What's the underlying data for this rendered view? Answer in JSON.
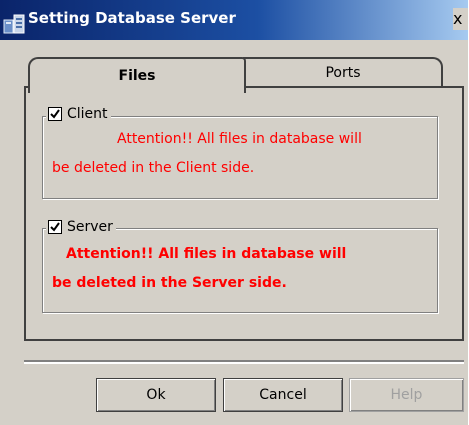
{
  "window": {
    "title": "Setting Database Server",
    "close_label": "x"
  },
  "tabs": [
    {
      "label": "Files",
      "selected": true
    },
    {
      "label": "Ports",
      "selected": false
    }
  ],
  "groups": {
    "client": {
      "label": "Client",
      "checked": true,
      "warning_line1": "Attention!! All files in database will",
      "warning_line2": "be deleted in the Client side."
    },
    "server": {
      "label": "Server",
      "checked": true,
      "warning_line1": "Attention!! All files in database will",
      "warning_line2": "be deleted in the Server side."
    }
  },
  "buttons": {
    "ok": "Ok",
    "cancel": "Cancel",
    "help": "Help"
  },
  "colors": {
    "warning_text": "#ff0000",
    "title_bar": "#0a246a",
    "dialog_face": "#d4d0c8",
    "disabled_text": "#a0a0a0"
  }
}
